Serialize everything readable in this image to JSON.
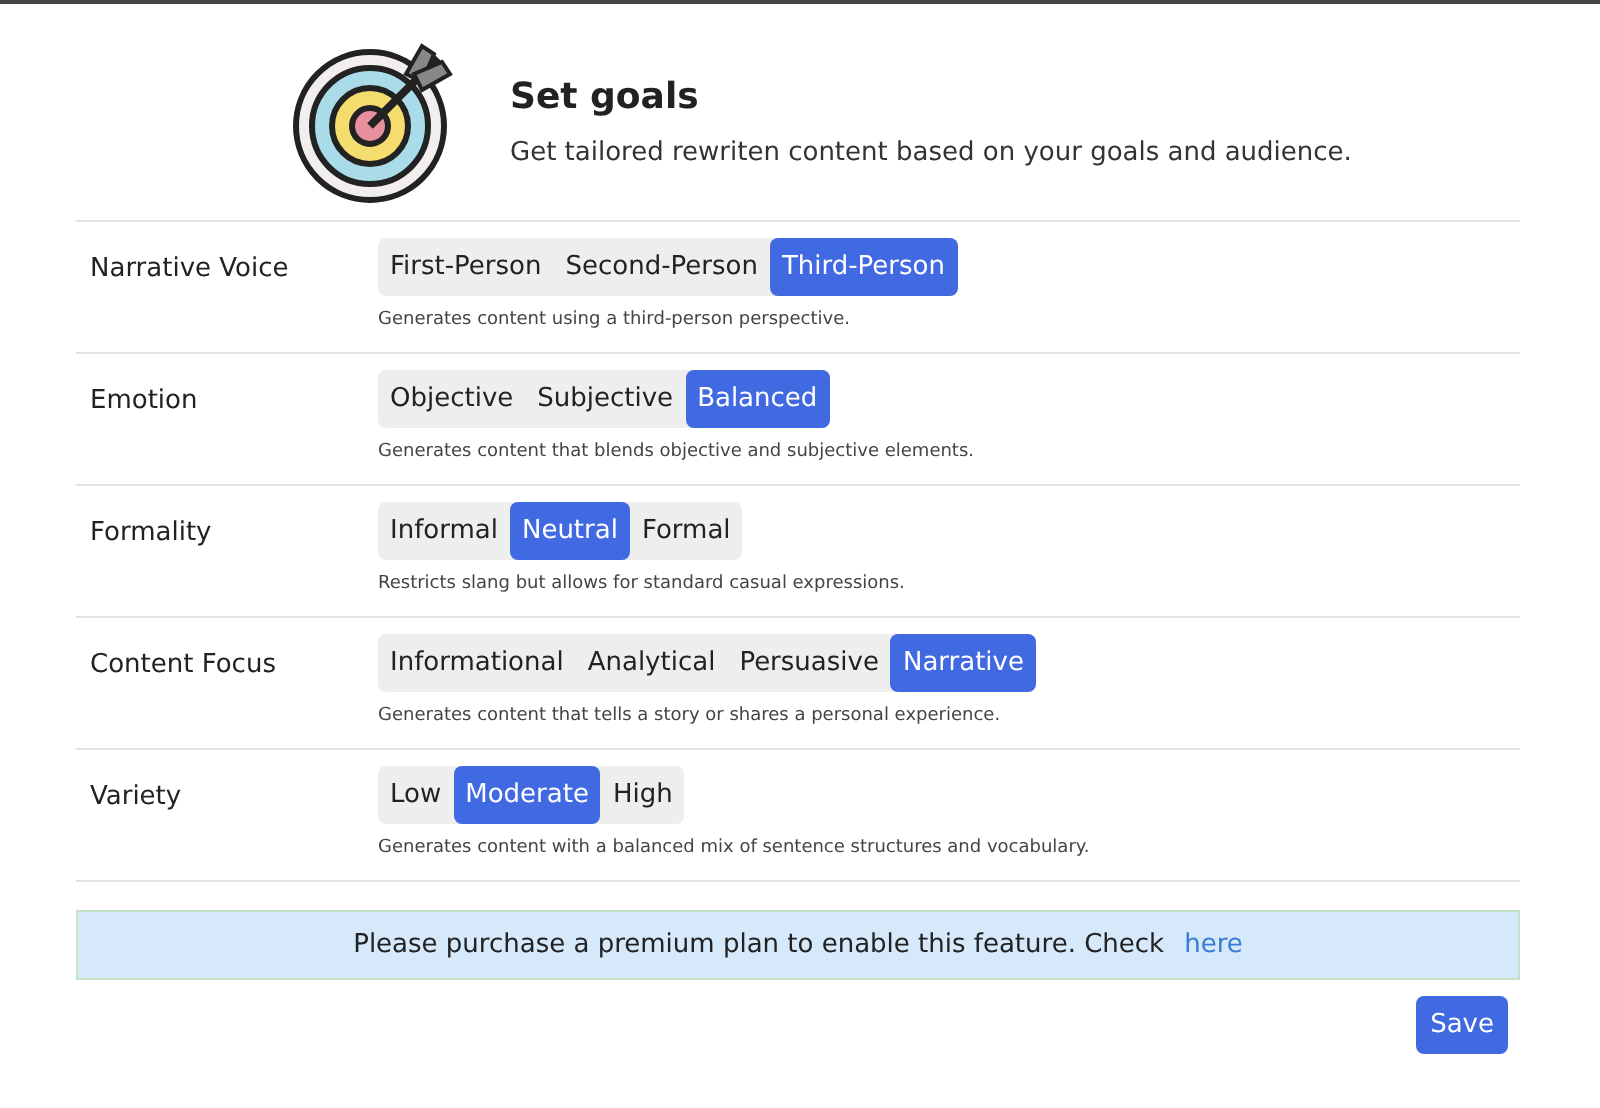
{
  "header": {
    "title": "Set goals",
    "subtitle": "Get tailored rewriten content based on your goals and audience."
  },
  "settings": [
    {
      "label": "Narrative Voice",
      "options": [
        {
          "label": "First-Person",
          "selected": false
        },
        {
          "label": "Second-Person",
          "selected": false
        },
        {
          "label": "Third-Person",
          "selected": true
        }
      ],
      "description": "Generates content using a third-person perspective."
    },
    {
      "label": "Emotion",
      "options": [
        {
          "label": "Objective",
          "selected": false
        },
        {
          "label": "Subjective",
          "selected": false
        },
        {
          "label": "Balanced",
          "selected": true
        }
      ],
      "description": "Generates content that blends objective and subjective elements."
    },
    {
      "label": "Formality",
      "options": [
        {
          "label": "Informal",
          "selected": false
        },
        {
          "label": "Neutral",
          "selected": true
        },
        {
          "label": "Formal",
          "selected": false
        }
      ],
      "description": "Restricts slang but allows for standard casual expressions."
    },
    {
      "label": "Content Focus",
      "options": [
        {
          "label": "Informational",
          "selected": false
        },
        {
          "label": "Analytical",
          "selected": false
        },
        {
          "label": "Persuasive",
          "selected": false
        },
        {
          "label": "Narrative",
          "selected": true
        }
      ],
      "description": "Generates content that tells a story or shares a personal experience."
    },
    {
      "label": "Variety",
      "options": [
        {
          "label": "Low",
          "selected": false
        },
        {
          "label": "Moderate",
          "selected": true
        },
        {
          "label": "High",
          "selected": false
        }
      ],
      "description": "Generates content with a balanced mix of sentence structures and vocabulary."
    }
  ],
  "notice": {
    "text": "Please purchase a premium plan to enable this feature. Check",
    "link": "here"
  },
  "save_button": "Save"
}
